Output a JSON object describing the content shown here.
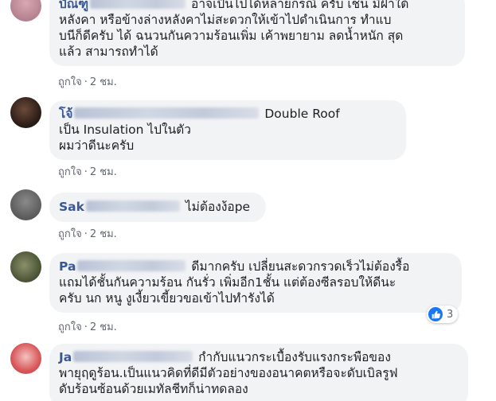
{
  "comments": [
    {
      "name_visible": "บัณฑู",
      "lines": [
        "อาจเป็นไปได้หลายกรณี ครับ เช่น มีฝ้าใต้",
        "หลังคา หรือข้างล่างหลังคาไม่สะดวกให้เข้าไปดำเนินการ ทำแบ",
        "บนีก็ดีครับ ได้ ฉนวนกันความร้อนเพิ่ม เค้าพยายาม ลดน้ำหนัก สุด",
        "แล้ว สามารถทำได้"
      ],
      "like": "ถูกใจ",
      "time": "2 ชม."
    },
    {
      "name_visible": "โจ้",
      "line1_tail": "Double Roof",
      "lines": [
        "เป็น Insulation ไปในตัว",
        "ผมว่าดีนะครับ"
      ],
      "like": "ถูกใจ",
      "time": "2 ชม."
    },
    {
      "name_visible": "Sak",
      "text": "ไม่ต้องง้อpe",
      "like": "ถูกใจ",
      "time": "2 ชม."
    },
    {
      "name_visible": "Pa",
      "line1_tail": "ดีมากครับ เปลี่ยนสะดวกรวดเร็วไม่ต้องรื้อ",
      "lines": [
        "แถมได้ชั้นกันความร้อน กันรั่ว เพิ่มอีก1ชั้น แต่ต้องซีลรอบให้ดีนะ",
        "ครับ นก หนู งูเงี้ยวเขี้ยวขอเข้าไปทำรังได้"
      ],
      "like": "ถูกใจ",
      "time": "2 ชม.",
      "reaction_count": "3"
    },
    {
      "name_visible": "Ja",
      "line1_tail": "กำกับแนวกระเบื้องรับแรงกระพือของ",
      "lines": [
        "พายุฤดูร้อน.เป็นแนวคิดที่ดีมีตัวอย่างของอนาคตหรือจะดับเบิลรูฟ",
        "ดับร้อนซ้อนด้วยเมทัลชีทก็น่าทดลอง"
      ]
    }
  ],
  "separator": "·",
  "colors": {
    "bubble": "#f2f3f5",
    "name": "#385898",
    "meta": "#606770",
    "like_blue": "#1877f2"
  }
}
